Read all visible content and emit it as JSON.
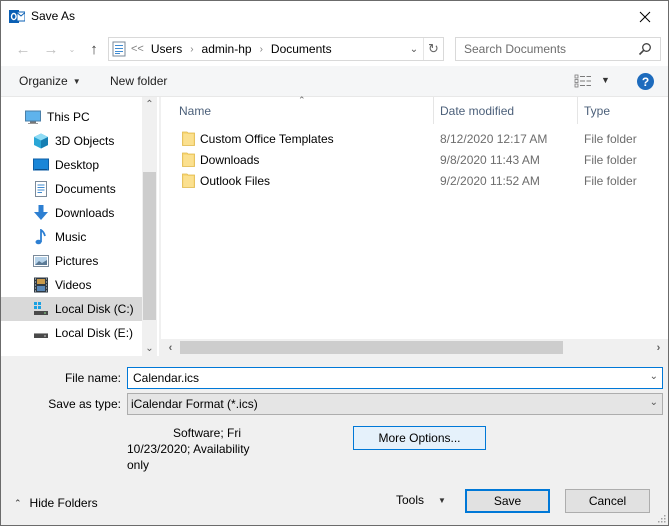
{
  "window": {
    "title": "Save As"
  },
  "address": {
    "overflow": "<<",
    "crumbs": [
      "Users",
      "admin-hp",
      "Documents"
    ],
    "separator": ">"
  },
  "search": {
    "placeholder": "Search Documents"
  },
  "toolbar": {
    "organize_label": "Organize",
    "new_folder_label": "New folder",
    "help_label": "?"
  },
  "nav": {
    "items": [
      {
        "label": "This PC",
        "icon": "computer-icon",
        "selected": false
      },
      {
        "label": "3D Objects",
        "icon": "3d-objects-icon",
        "selected": false
      },
      {
        "label": "Desktop",
        "icon": "desktop-icon",
        "selected": false
      },
      {
        "label": "Documents",
        "icon": "documents-icon",
        "selected": false
      },
      {
        "label": "Downloads",
        "icon": "downloads-icon",
        "selected": false
      },
      {
        "label": "Music",
        "icon": "music-icon",
        "selected": false
      },
      {
        "label": "Pictures",
        "icon": "pictures-icon",
        "selected": false
      },
      {
        "label": "Videos",
        "icon": "videos-icon",
        "selected": false
      },
      {
        "label": "Local Disk (C:)",
        "icon": "system-drive-icon",
        "selected": true
      },
      {
        "label": "Local Disk (E:)",
        "icon": "drive-icon",
        "selected": false
      }
    ]
  },
  "files": {
    "columns": {
      "name": "Name",
      "date": "Date modified",
      "type": "Type"
    },
    "rows": [
      {
        "name": "Custom Office Templates",
        "date": "8/12/2020 12:17 AM",
        "type": "File folder"
      },
      {
        "name": "Downloads",
        "date": "9/8/2020 11:43 AM",
        "type": "File folder"
      },
      {
        "name": "Outlook Files",
        "date": "9/2/2020 11:52 AM",
        "type": "File folder"
      }
    ]
  },
  "form": {
    "file_name_label": "File name:",
    "file_name_value": "Calendar.ics",
    "save_type_label": "Save as type:",
    "save_type_value": "iCalendar Format (*.ics)",
    "metadata_line1": "Software; Fri",
    "metadata_line2": "10/23/2020; Availability",
    "metadata_line3": "only",
    "more_options_label": "More Options..."
  },
  "footer": {
    "hide_folders_label": "Hide Folders",
    "tools_label": "Tools",
    "save_label": "Save",
    "cancel_label": "Cancel"
  },
  "colors": {
    "accent": "#0078d7",
    "help_blue": "#1d6bbd",
    "folder_yellow": "#f8d775",
    "selected_nav": "#d9d9d9"
  }
}
